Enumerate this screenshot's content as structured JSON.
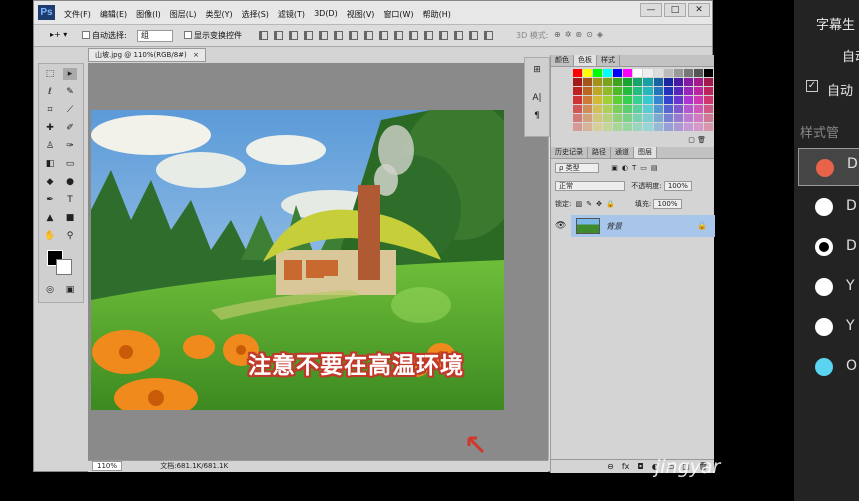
{
  "app": {
    "logo": "Ps"
  },
  "menu": [
    "文件(F)",
    "编辑(E)",
    "图像(I)",
    "图层(L)",
    "类型(Y)",
    "选择(S)",
    "滤镜(T)",
    "3D(D)",
    "视图(V)",
    "窗口(W)",
    "帮助(H)"
  ],
  "window_controls": {
    "minimize": "—",
    "maximize": "□",
    "close": "✕"
  },
  "options": {
    "auto_select_label": "自动选择:",
    "auto_select_value": "组",
    "show_transform_label": "显示变换控件",
    "mode3d_label": "3D 模式:"
  },
  "document": {
    "tab_label": "山坡.jpg @ 110%(RGB/8#)",
    "close_glyph": "×",
    "caption": "注意不要在高温环境"
  },
  "status": {
    "zoom": "110%",
    "doc_size": "文档:681.1K/681.1K"
  },
  "panels": {
    "swatch_tabs": [
      "颜色",
      "色板",
      "样式"
    ],
    "layer_tabs": [
      "历史记录",
      "路径",
      "通道",
      "图层"
    ],
    "filter_label": "ρ 类型",
    "blend_mode": "正常",
    "opacity_label": "不透明度:",
    "opacity_value": "100%",
    "lock_label": "锁定:",
    "fill_label": "填充:",
    "fill_value": "100%",
    "layer_name": "背景"
  },
  "side_panel": {
    "subtitle_label": "字幕生",
    "auto_label": "自动",
    "auto_check_label": "自动",
    "style_manage_label": "样式管",
    "styles": [
      {
        "letter": "D",
        "color": "#e8634a"
      },
      {
        "letter": "D",
        "color": "#ffffff"
      },
      {
        "letter": "D",
        "color": "#ffffff"
      },
      {
        "letter": "Y",
        "color": "#ffffff"
      },
      {
        "letter": "Y",
        "color": "#ffffff"
      },
      {
        "letter": "O",
        "color": "#5ad4f0"
      }
    ]
  },
  "watermark": "jingyar",
  "colors": {
    "caption_outline": "#c0392b",
    "layer_selected": "#a8c6ea"
  }
}
